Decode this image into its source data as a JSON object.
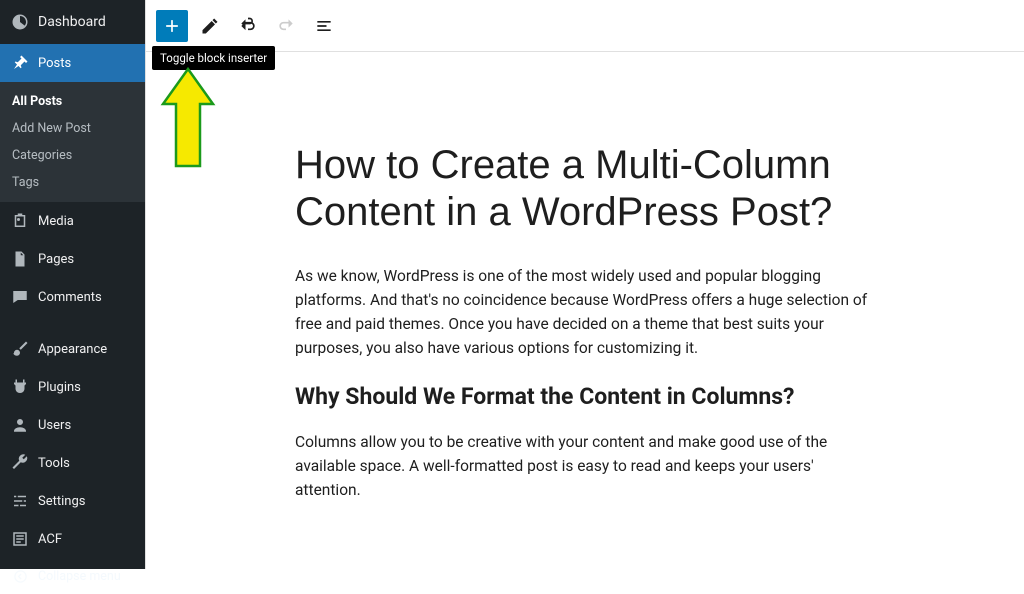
{
  "sidebar": {
    "dashboard": "Dashboard",
    "posts": "Posts",
    "sub": {
      "all": "All Posts",
      "add": "Add New Post",
      "cats": "Categories",
      "tags": "Tags"
    },
    "media": "Media",
    "pages": "Pages",
    "comments": "Comments",
    "appearance": "Appearance",
    "plugins": "Plugins",
    "users": "Users",
    "tools": "Tools",
    "settings": "Settings",
    "acf": "ACF",
    "collapse": "Collapse menu"
  },
  "tooltip": "Toggle block inserter",
  "post": {
    "title": "How to Create a Multi-Column Content in a WordPress Post?",
    "p1": "As we know, WordPress is one of the most widely used and popular blogging platforms. And that's no coincidence because WordPress offers a huge selection of free and paid themes. Once you have decided on a theme that best suits your purposes, you also have various options for customizing it.",
    "h2": "Why Should We Format the Content in Columns?",
    "p2": "Columns allow you to be creative with your content and make good use of the available space. A well-formatted post is easy to read and keeps your users' attention."
  }
}
